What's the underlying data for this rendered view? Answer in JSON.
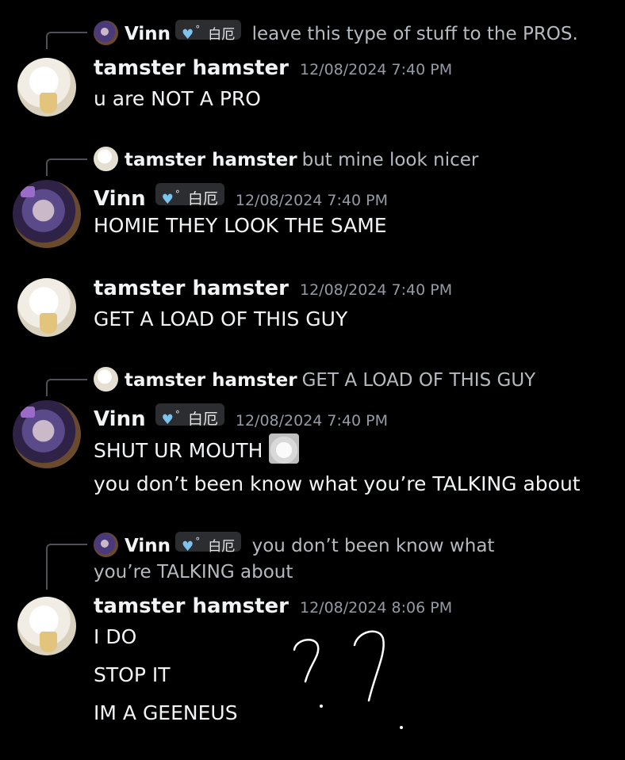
{
  "colors": {
    "background": "#000000",
    "username": "#f2f3f5",
    "timestamp": "#949ba4",
    "reply_text": "#b5bac1",
    "badge_bg": "#2b2d31",
    "heart": "#7cc4f0"
  },
  "messages": [
    {
      "reply": {
        "author": "Vinn",
        "badge": {
          "icon": "blue-heart-icon",
          "deg": "°",
          "tag": "白厄"
        },
        "text": "leave this type of stuff to the PROS."
      },
      "author": "tamster hamster",
      "timestamp": "12/08/2024 7:40 PM",
      "lines": [
        "u are NOT A PRO"
      ]
    },
    {
      "reply": {
        "author": "tamster hamster",
        "text": "but mine look nicer"
      },
      "author": "Vinn",
      "badge": {
        "icon": "blue-heart-icon",
        "deg": "°",
        "tag": "白厄"
      },
      "timestamp": "12/08/2024 7:40 PM",
      "lines": [
        "HOMIE THEY LOOK THE SAME"
      ]
    },
    {
      "author": "tamster hamster",
      "timestamp": "12/08/2024 7:40 PM",
      "lines": [
        "GET A LOAD OF THIS GUY"
      ]
    },
    {
      "reply": {
        "author": "tamster hamster",
        "text": "GET A LOAD OF THIS GUY"
      },
      "author": "Vinn",
      "badge": {
        "icon": "blue-heart-icon",
        "deg": "°",
        "tag": "白厄"
      },
      "timestamp": "12/08/2024 7:40 PM",
      "lines": [
        "SHUT UR MOUTH",
        "you don’t been know what you’re TALKING about"
      ],
      "sticker": "cat-sticker"
    },
    {
      "reply": {
        "author": "Vinn",
        "badge": {
          "icon": "blue-heart-icon",
          "deg": "°",
          "tag": "白厄"
        },
        "text": "you don’t been know what you’re TALKING about"
      },
      "author": "tamster hamster",
      "timestamp": "12/08/2024 8:06 PM",
      "lines": [
        "I DO",
        "STOP IT",
        "IM A GEENEUS"
      ]
    }
  ],
  "drawing": {
    "icon": "handwritten-question-marks"
  }
}
